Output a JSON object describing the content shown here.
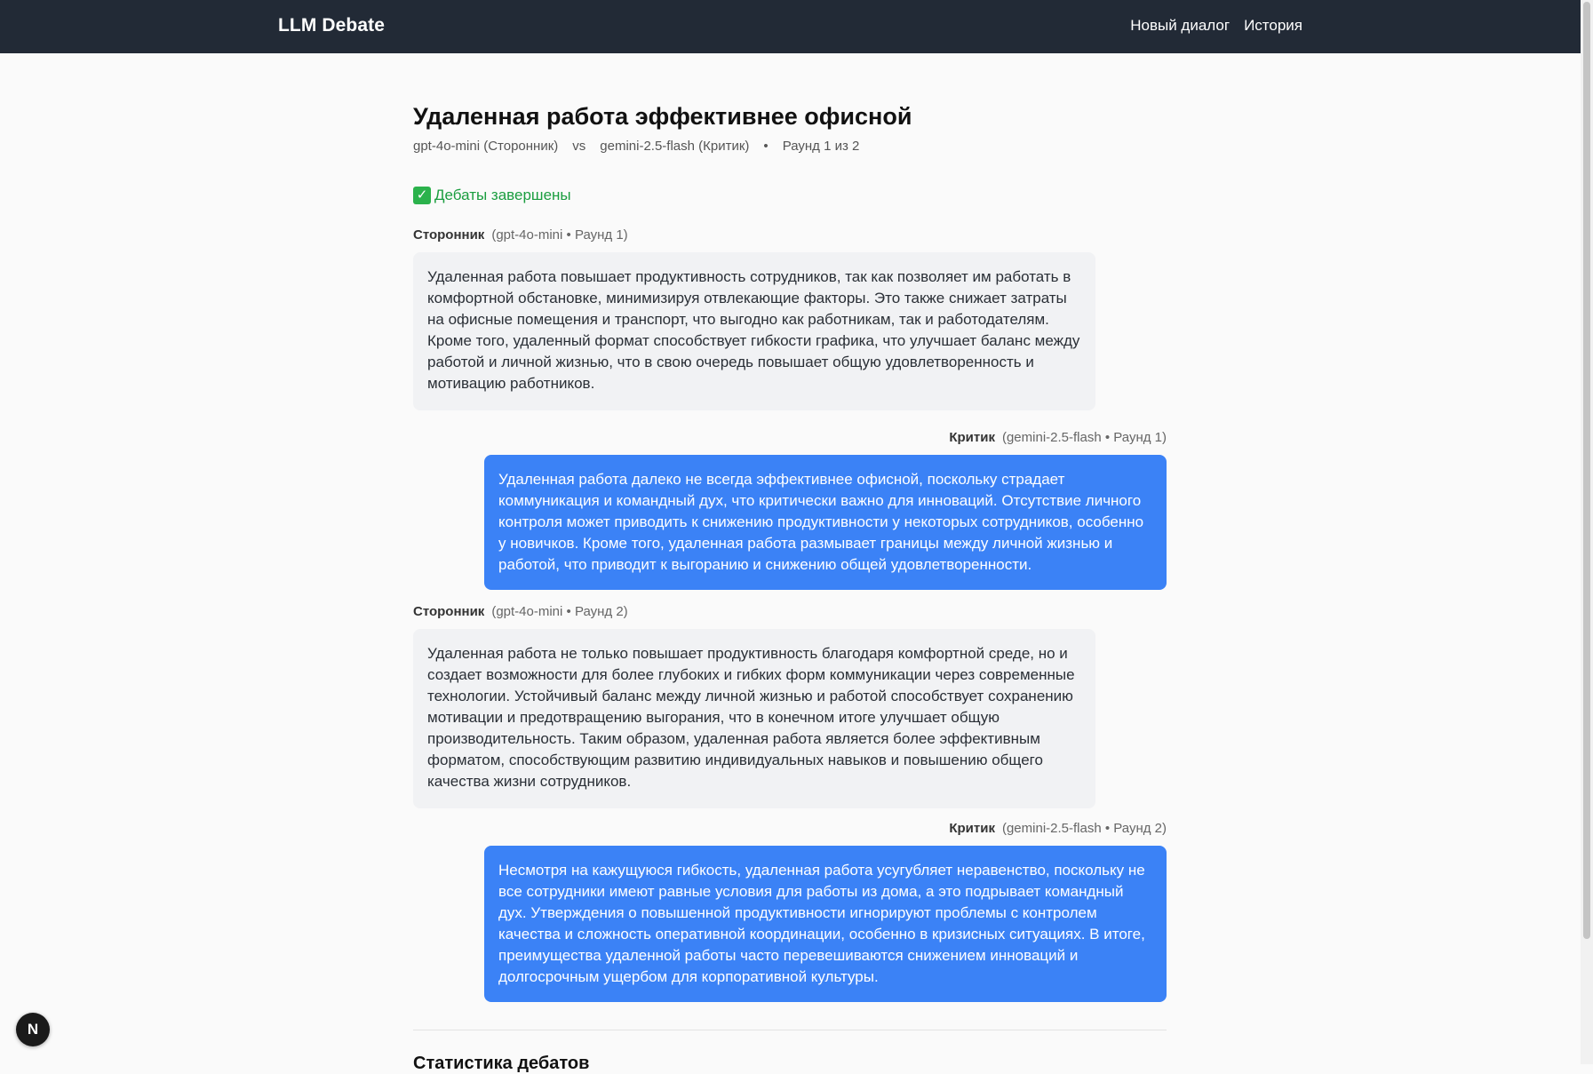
{
  "header": {
    "brand": "LLM Debate",
    "nav": [
      "Новый диалог",
      "История"
    ]
  },
  "debate": {
    "title": "Удаленная работа эффективнее офисной",
    "pro_model": "gpt-4o-mini (Сторонник)",
    "vs": "vs",
    "con_model": "gemini-2.5-flash (Критик)",
    "dot": "•",
    "round_info": "Раунд 1 из 2",
    "status_icon": "✓",
    "status": "Дебаты завершены"
  },
  "messages": [
    {
      "side": "pro",
      "role": "Сторонник",
      "meta": "(gpt-4o-mini • Раунд 1)",
      "text": "Удаленная работа повышает продуктивность сотрудников, так как позволяет им работать в комфортной обстановке, минимизируя отвлекающие факторы. Это также снижает затраты на офисные помещения и транспорт, что выгодно как работникам, так и работодателям. Кроме того, удаленный формат способствует гибкости графика, что улучшает баланс между работой и личной жизнью, что в свою очередь повышает общую удовлетворенность и мотивацию работников."
    },
    {
      "side": "con",
      "role": "Критик",
      "meta": "(gemini-2.5-flash • Раунд 1)",
      "text": "Удаленная работа далеко не всегда эффективнее офисной, поскольку страдает коммуникация и командный дух, что критически важно для инноваций. Отсутствие личного контроля может приводить к снижению продуктивности у некоторых сотрудников, особенно у новичков. Кроме того, удаленная работа размывает границы между личной жизнью и работой, что приводит к выгоранию и снижению общей удовлетворенности."
    },
    {
      "side": "pro",
      "role": "Сторонник",
      "meta": "(gpt-4o-mini • Раунд 2)",
      "text": "Удаленная работа не только повышает продуктивность благодаря комфортной среде, но и создает возможности для более глубоких и гибких форм коммуникации через современные технологии. Устойчивый баланс между личной жизнью и работой способствует сохранению мотивации и предотвращению выгорания, что в конечном итоге улучшает общую производительность. Таким образом, удаленная работа является более эффективным форматом, способствующим развитию индивидуальных навыков и повышению общего качества жизни сотрудников."
    },
    {
      "side": "con",
      "role": "Критик",
      "meta": "(gemini-2.5-flash • Раунд 2)",
      "text": "Несмотря на кажущуюся гибкость, удаленная работа усугубляет неравенство, поскольку не все сотрудники имеют равные условия для работы из дома, а это подрывает командный дух. Утверждения о повышенной продуктивности игнорируют проблемы с контролем качества и сложность оперативной координации, особенно в кризисных ситуациях. В итоге, преимущества удаленной работы часто перевешиваются снижением инноваций и долгосрочным ущербом для корпоративной культуры."
    }
  ],
  "stats": {
    "title": "Статистика дебатов"
  },
  "fab": {
    "label": "N"
  }
}
